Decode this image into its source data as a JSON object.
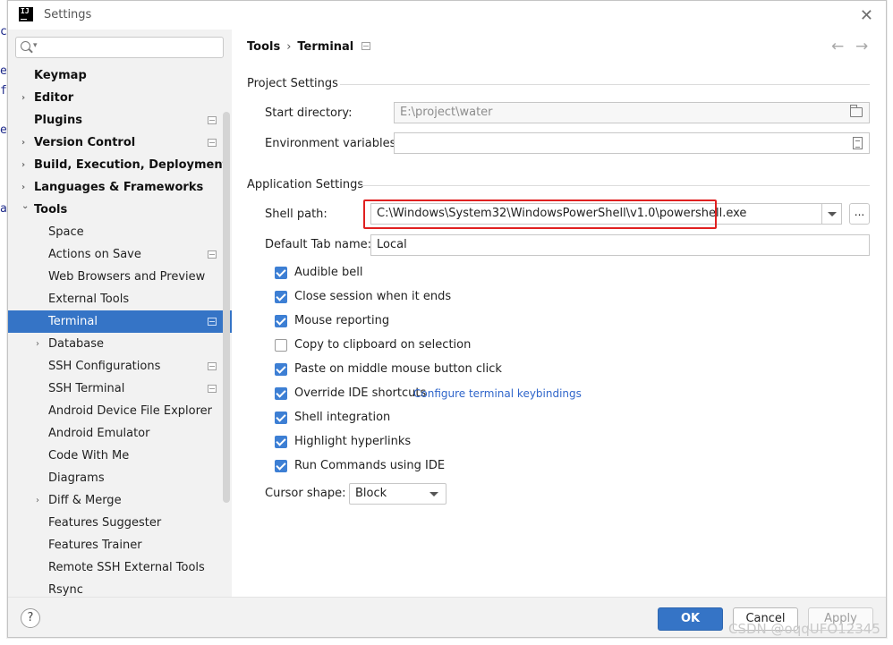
{
  "window": {
    "title": "Settings",
    "app_icon": "IJ"
  },
  "sidebar": {
    "search_placeholder": "",
    "items": [
      {
        "label": "Keymap",
        "level": 0,
        "chevron": "",
        "project": false
      },
      {
        "label": "Editor",
        "level": 0,
        "chevron": "›",
        "project": false
      },
      {
        "label": "Plugins",
        "level": 0,
        "chevron": "",
        "project": true
      },
      {
        "label": "Version Control",
        "level": 0,
        "chevron": "›",
        "project": true
      },
      {
        "label": "Build, Execution, Deployment",
        "level": 0,
        "chevron": "›",
        "project": false
      },
      {
        "label": "Languages & Frameworks",
        "level": 0,
        "chevron": "›",
        "project": false
      },
      {
        "label": "Tools",
        "level": 0,
        "chevron": "⌄",
        "project": false
      },
      {
        "label": "Space",
        "level": 1,
        "chevron": "",
        "project": false
      },
      {
        "label": "Actions on Save",
        "level": 1,
        "chevron": "",
        "project": true
      },
      {
        "label": "Web Browsers and Preview",
        "level": 1,
        "chevron": "",
        "project": false
      },
      {
        "label": "External Tools",
        "level": 1,
        "chevron": "",
        "project": false
      },
      {
        "label": "Terminal",
        "level": 1,
        "chevron": "",
        "project": true,
        "selected": true
      },
      {
        "label": "Database",
        "level": 1,
        "chevron": "›",
        "project": false
      },
      {
        "label": "SSH Configurations",
        "level": 1,
        "chevron": "",
        "project": true
      },
      {
        "label": "SSH Terminal",
        "level": 1,
        "chevron": "",
        "project": true
      },
      {
        "label": "Android Device File Explorer",
        "level": 1,
        "chevron": "",
        "project": false
      },
      {
        "label": "Android Emulator",
        "level": 1,
        "chevron": "",
        "project": false
      },
      {
        "label": "Code With Me",
        "level": 1,
        "chevron": "",
        "project": false
      },
      {
        "label": "Diagrams",
        "level": 1,
        "chevron": "",
        "project": false
      },
      {
        "label": "Diff & Merge",
        "level": 1,
        "chevron": "›",
        "project": false
      },
      {
        "label": "Features Suggester",
        "level": 1,
        "chevron": "",
        "project": false
      },
      {
        "label": "Features Trainer",
        "level": 1,
        "chevron": "",
        "project": false
      },
      {
        "label": "Remote SSH External Tools",
        "level": 1,
        "chevron": "",
        "project": false
      },
      {
        "label": "Rsync",
        "level": 1,
        "chevron": "",
        "project": false
      }
    ]
  },
  "breadcrumb": {
    "parent": "Tools",
    "separator": "›",
    "current": "Terminal"
  },
  "nav": {
    "back": "←",
    "forward": "→"
  },
  "project_settings": {
    "title": "Project Settings",
    "start_directory_label": "Start directory:",
    "start_directory_value": "E:\\project\\water",
    "env_vars_label": "Environment variables:",
    "env_vars_value": ""
  },
  "application_settings": {
    "title": "Application Settings",
    "shell_path_label": "Shell path:",
    "shell_path_value": "C:\\Windows\\System32\\WindowsPowerShell\\v1.0\\powershell.exe",
    "browse_label": "...",
    "default_tab_label": "Default Tab name:",
    "default_tab_value": "Local",
    "checkboxes": [
      {
        "label": "Audible bell",
        "checked": true
      },
      {
        "label": "Close session when it ends",
        "checked": true
      },
      {
        "label": "Mouse reporting",
        "checked": true
      },
      {
        "label": "Copy to clipboard on selection",
        "checked": false
      },
      {
        "label": "Paste on middle mouse button click",
        "checked": true
      },
      {
        "label": "Override IDE shortcuts",
        "checked": true
      },
      {
        "label": "Shell integration",
        "checked": true
      },
      {
        "label": "Highlight hyperlinks",
        "checked": true
      },
      {
        "label": "Run Commands using IDE",
        "checked": true
      }
    ],
    "configure_link": "Configure terminal keybindings",
    "cursor_shape_label": "Cursor shape:",
    "cursor_shape_value": "Block"
  },
  "footer": {
    "help": "?",
    "ok": "OK",
    "cancel": "Cancel",
    "apply": "Apply"
  },
  "watermark": "CSDN @oqqUFO12345",
  "colors": {
    "accent": "#3574c6",
    "highlight_box": "#e02020",
    "link": "#2f65ca",
    "checkbox": "#3d7fd4"
  }
}
